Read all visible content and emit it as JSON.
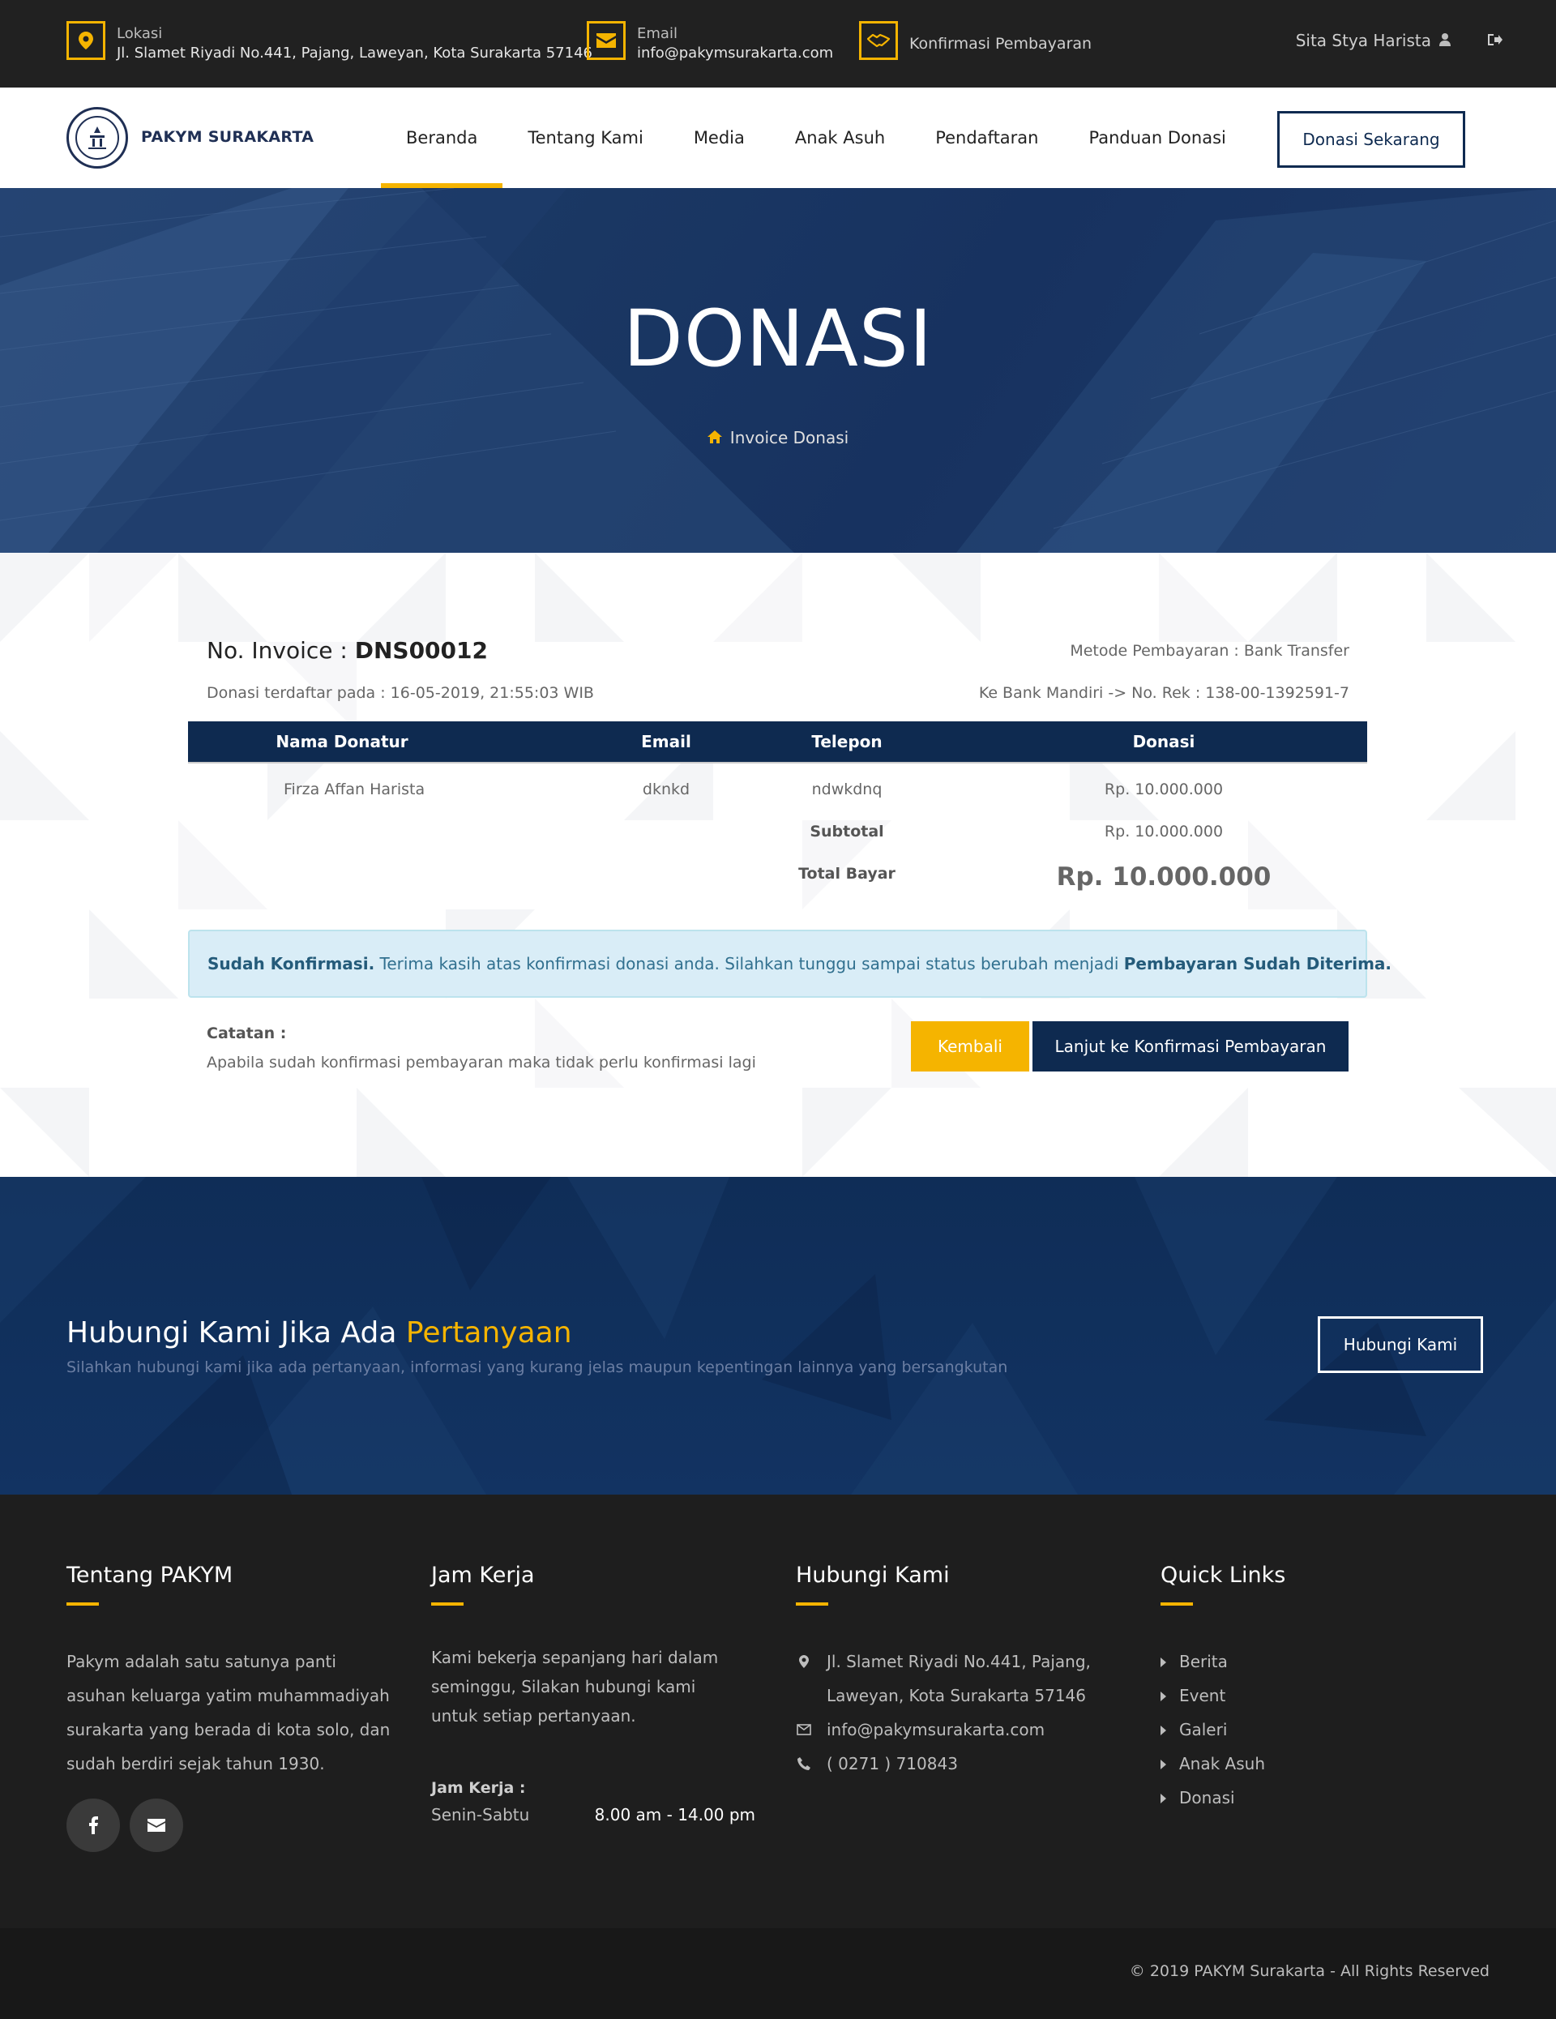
{
  "topbar": {
    "location_label": "Lokasi",
    "location_value": "Jl. Slamet Riyadi No.441, Pajang, Laweyan, Kota Surakarta 57146",
    "email_label": "Email",
    "email_value": "info@pakymsurakarta.com",
    "confirm_label": "Konfirmasi Pembayaran",
    "user_name": "Sita Stya Harista",
    "icons": [
      "map-pin-icon",
      "envelope-icon",
      "handshake-icon",
      "user-icon",
      "sign-out-icon"
    ]
  },
  "nav": {
    "logo_text": "PAKYM SURAKARTA",
    "items": [
      "Beranda",
      "Tentang Kami",
      "Media",
      "Anak Asuh",
      "Pendaftaran",
      "Panduan Donasi"
    ],
    "active_index": 0,
    "cta": "Donasi Sekarang"
  },
  "hero": {
    "title": "DONASI",
    "breadcrumb": "Invoice Donasi"
  },
  "invoice": {
    "number_label": "No. Invoice :",
    "number": "DNS00012",
    "registered": "Donasi terdaftar pada : 16-05-2019, 21:55:03 WIB",
    "method": "Metode Pembayaran : Bank Transfer",
    "bank": "Ke Bank Mandiri -> No. Rek : 138-00-1392591-7",
    "columns": [
      "Nama Donatur",
      "Email",
      "Telepon",
      "Donasi"
    ],
    "row": {
      "name": "Firza Affan Harista",
      "email": "dknkd",
      "phone": "ndwkdnq",
      "amount": "Rp. 10.000.000"
    },
    "subtotal_label": "Subtotal",
    "subtotal_value": "Rp. 10.000.000",
    "total_label": "Total Bayar",
    "total_value": "Rp. 10.000.000",
    "alert_strong": "Sudah Konfirmasi.",
    "alert_text": " Terima kasih atas konfirmasi donasi anda. Silahkan tunggu sampai status berubah menjadi ",
    "alert_status": "Pembayaran Sudah Diterima.",
    "note_label": "Catatan :",
    "note_text": "Apabila sudah konfirmasi pembayaran maka tidak perlu konfirmasi lagi",
    "back_button": "Kembali",
    "next_button": "Lanjut ke Konfirmasi Pembayaran"
  },
  "contact_cta": {
    "title_main": "Hubungi Kami Jika Ada ",
    "title_highlight": "Pertanyaan",
    "subtitle": "Silahkan hubungi kami jika ada pertanyaan, informasi yang kurang jelas maupun kepentingan lainnya yang bersangkutan",
    "button": "Hubungi Kami"
  },
  "footer": {
    "about_title": "Tentang PAKYM",
    "about_text": "Pakym adalah satu satunya panti asuhan keluarga yatim muhammadiyah surakarta yang berada di kota solo, dan sudah berdiri sejak tahun 1930.",
    "hours_title": "Jam Kerja",
    "hours_text": "Kami bekerja sepanjang hari dalam seminggu, Silakan hubungi kami untuk setiap pertanyaan.",
    "hours_label": "Jam Kerja :",
    "hours_days": "Senin-Sabtu",
    "hours_time": "8.00 am - 14.00 pm",
    "contact_title": "Hubungi Kami",
    "contact_address_1": "Jl. Slamet Riyadi No.441, Pajang,",
    "contact_address_2": "Laweyan, Kota Surakarta 57146",
    "contact_email": "info@pakymsurakarta.com",
    "contact_phone": "( 0271 ) 710843",
    "links_title": "Quick Links",
    "links": [
      "Berita",
      "Event",
      "Galeri",
      "Anak Asuh",
      "Donasi"
    ],
    "copyright": "© 2019 PAKYM Surakarta - All Rights Reserved"
  },
  "colors": {
    "accent": "#f5b400",
    "navy": "#0e2a50",
    "dark": "#212121"
  }
}
